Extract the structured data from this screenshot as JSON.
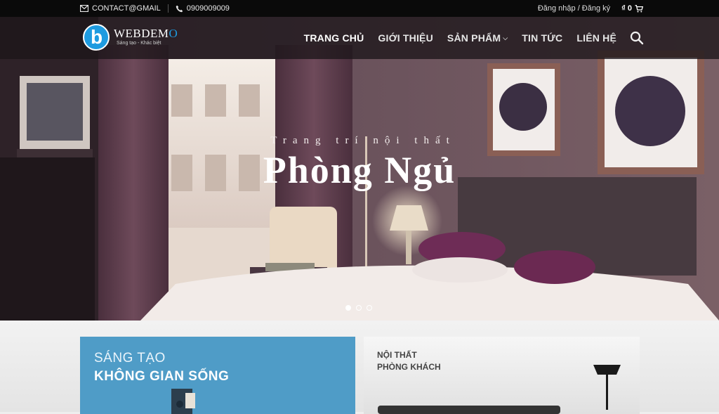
{
  "topbar": {
    "email": "CONTACT@GMAIL",
    "phone": "0909009009",
    "login": "Đăng nhập / Đăng ký",
    "cart_amount": "₫ 0"
  },
  "logo": {
    "name_main": "WEBDEM",
    "name_last": "O",
    "slogan": "Sáng tạo - Khác biệt"
  },
  "nav": {
    "items": [
      {
        "label": "TRANG CHỦ",
        "active": true
      },
      {
        "label": "GIỚI THIỆU"
      },
      {
        "label": "SẢN PHẨM",
        "has_dropdown": true
      },
      {
        "label": "TIN TỨC"
      },
      {
        "label": "LIÊN HỆ"
      }
    ]
  },
  "hero": {
    "subtitle": "Trang trí nội thất",
    "title": "Phòng Ngủ",
    "slides": 3,
    "active_slide": 1
  },
  "cards": [
    {
      "line1": "SÁNG TẠO",
      "line2": "KHÔNG GIAN SỐNG",
      "color": "#4f9cc7"
    },
    {
      "line1": "NỘI THẤT",
      "line2": "PHÒNG KHÁCH"
    }
  ],
  "colors": {
    "accent": "#1e9be0",
    "topbar": "#0a0a0a"
  }
}
